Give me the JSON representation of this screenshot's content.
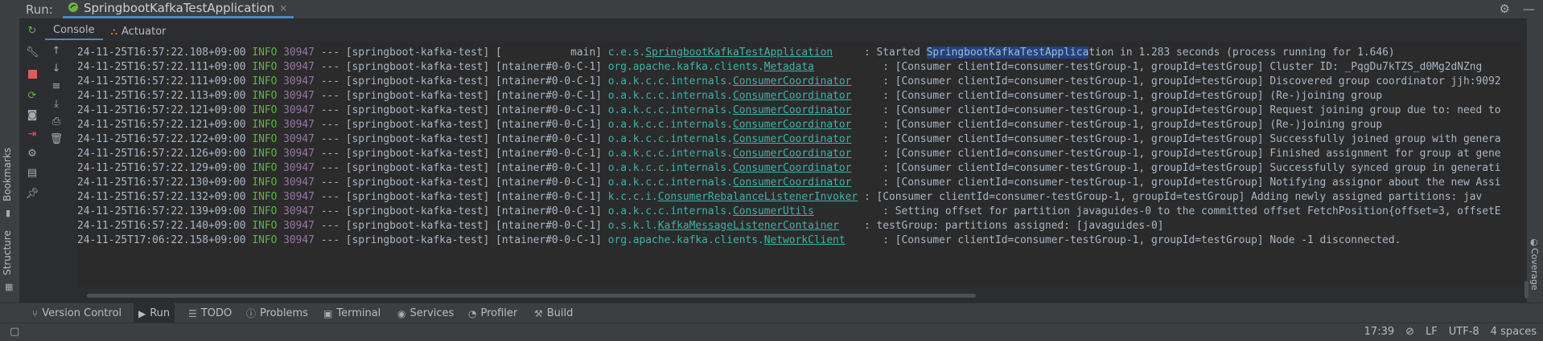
{
  "titlebar": {
    "run_label": "Run:",
    "tab_name": "SpringbootKafkaTestApplication",
    "close_glyph": "×"
  },
  "sidebar": {
    "bookmarks": "Bookmarks",
    "structure": "Structure",
    "coverage": "Coverage"
  },
  "subtabs": [
    {
      "label": "Console"
    },
    {
      "label": "Actuator"
    }
  ],
  "log": [
    {
      "ts": "24-11-25T16:57:22.108+09:00",
      "level": "INFO",
      "pid": "30947",
      "sep": "---",
      "app": "[springboot-kafka-test]",
      "thread": "[           main]",
      "logger_prefix": "c.e.s.",
      "logger_link": "SpringbootKafkaTestApplication",
      "logger_pad": "     ",
      "msg_pre": ": Started ",
      "msg_hl": "SpringbootKafkaTestApplica",
      "msg_post": "tion in 1.283 seconds (process running for 1.646)"
    },
    {
      "ts": "24-11-25T16:57:22.111+09:00",
      "level": "INFO",
      "pid": "30947",
      "sep": "---",
      "app": "[springboot-kafka-test]",
      "thread": "[ntainer#0-0-C-1]",
      "logger_prefix": "org.apache.kafka.clients.",
      "logger_link": "Metadata",
      "logger_pad": "           ",
      "msg_pre": ": [Consumer clientId=consumer-testGroup-1, groupId=testGroup] Cluster ID: _PqgDu7kTZS_d0Mg2dNZng",
      "msg_hl": "",
      "msg_post": ""
    },
    {
      "ts": "24-11-25T16:57:22.111+09:00",
      "level": "INFO",
      "pid": "30947",
      "sep": "---",
      "app": "[springboot-kafka-test]",
      "thread": "[ntainer#0-0-C-1]",
      "logger_prefix": "o.a.k.c.c.internals.",
      "logger_link": "ConsumerCoordinator",
      "logger_pad": "     ",
      "msg_pre": ": [Consumer clientId=consumer-testGroup-1, groupId=testGroup] Discovered group coordinator jjh:9092",
      "msg_hl": "",
      "msg_post": ""
    },
    {
      "ts": "24-11-25T16:57:22.113+09:00",
      "level": "INFO",
      "pid": "30947",
      "sep": "---",
      "app": "[springboot-kafka-test]",
      "thread": "[ntainer#0-0-C-1]",
      "logger_prefix": "o.a.k.c.c.internals.",
      "logger_link": "ConsumerCoordinator",
      "logger_pad": "     ",
      "msg_pre": ": [Consumer clientId=consumer-testGroup-1, groupId=testGroup] (Re-)joining group",
      "msg_hl": "",
      "msg_post": ""
    },
    {
      "ts": "24-11-25T16:57:22.121+09:00",
      "level": "INFO",
      "pid": "30947",
      "sep": "---",
      "app": "[springboot-kafka-test]",
      "thread": "[ntainer#0-0-C-1]",
      "logger_prefix": "o.a.k.c.c.internals.",
      "logger_link": "ConsumerCoordinator",
      "logger_pad": "     ",
      "msg_pre": ": [Consumer clientId=consumer-testGroup-1, groupId=testGroup] Request joining group due to: need to",
      "msg_hl": "",
      "msg_post": ""
    },
    {
      "ts": "24-11-25T16:57:22.121+09:00",
      "level": "INFO",
      "pid": "30947",
      "sep": "---",
      "app": "[springboot-kafka-test]",
      "thread": "[ntainer#0-0-C-1]",
      "logger_prefix": "o.a.k.c.c.internals.",
      "logger_link": "ConsumerCoordinator",
      "logger_pad": "     ",
      "msg_pre": ": [Consumer clientId=consumer-testGroup-1, groupId=testGroup] (Re-)joining group",
      "msg_hl": "",
      "msg_post": ""
    },
    {
      "ts": "24-11-25T16:57:22.122+09:00",
      "level": "INFO",
      "pid": "30947",
      "sep": "---",
      "app": "[springboot-kafka-test]",
      "thread": "[ntainer#0-0-C-1]",
      "logger_prefix": "o.a.k.c.c.internals.",
      "logger_link": "ConsumerCoordinator",
      "logger_pad": "     ",
      "msg_pre": ": [Consumer clientId=consumer-testGroup-1, groupId=testGroup] Successfully joined group with genera",
      "msg_hl": "",
      "msg_post": ""
    },
    {
      "ts": "24-11-25T16:57:22.126+09:00",
      "level": "INFO",
      "pid": "30947",
      "sep": "---",
      "app": "[springboot-kafka-test]",
      "thread": "[ntainer#0-0-C-1]",
      "logger_prefix": "o.a.k.c.c.internals.",
      "logger_link": "ConsumerCoordinator",
      "logger_pad": "     ",
      "msg_pre": ": [Consumer clientId=consumer-testGroup-1, groupId=testGroup] Finished assignment for group at gene",
      "msg_hl": "",
      "msg_post": ""
    },
    {
      "ts": "24-11-25T16:57:22.129+09:00",
      "level": "INFO",
      "pid": "30947",
      "sep": "---",
      "app": "[springboot-kafka-test]",
      "thread": "[ntainer#0-0-C-1]",
      "logger_prefix": "o.a.k.c.c.internals.",
      "logger_link": "ConsumerCoordinator",
      "logger_pad": "     ",
      "msg_pre": ": [Consumer clientId=consumer-testGroup-1, groupId=testGroup] Successfully synced group in generati",
      "msg_hl": "",
      "msg_post": ""
    },
    {
      "ts": "24-11-25T16:57:22.130+09:00",
      "level": "INFO",
      "pid": "30947",
      "sep": "---",
      "app": "[springboot-kafka-test]",
      "thread": "[ntainer#0-0-C-1]",
      "logger_prefix": "o.a.k.c.c.internals.",
      "logger_link": "ConsumerCoordinator",
      "logger_pad": "     ",
      "msg_pre": ": [Consumer clientId=consumer-testGroup-1, groupId=testGroup] Notifying assignor about the new Assi",
      "msg_hl": "",
      "msg_post": ""
    },
    {
      "ts": "24-11-25T16:57:22.132+09:00",
      "level": "INFO",
      "pid": "30947",
      "sep": "---",
      "app": "[springboot-kafka-test]",
      "thread": "[ntainer#0-0-C-1]",
      "logger_prefix": "k.c.c.i.",
      "logger_link": "ConsumerRebalanceListenerInvoker",
      "logger_pad": " ",
      "msg_pre": ": [Consumer clientId=consumer-testGroup-1, groupId=testGroup] Adding newly assigned partitions: jav",
      "msg_hl": "",
      "msg_post": ""
    },
    {
      "ts": "24-11-25T16:57:22.139+09:00",
      "level": "INFO",
      "pid": "30947",
      "sep": "---",
      "app": "[springboot-kafka-test]",
      "thread": "[ntainer#0-0-C-1]",
      "logger_prefix": "o.a.k.c.c.internals.",
      "logger_link": "ConsumerUtils",
      "logger_pad": "           ",
      "msg_pre": ": Setting offset for partition javaguides-0 to the committed offset FetchPosition{offset=3, offsetE",
      "msg_hl": "",
      "msg_post": ""
    },
    {
      "ts": "24-11-25T16:57:22.140+09:00",
      "level": "INFO",
      "pid": "30947",
      "sep": "---",
      "app": "[springboot-kafka-test]",
      "thread": "[ntainer#0-0-C-1]",
      "logger_prefix": "o.s.k.l.",
      "logger_link": "KafkaMessageListenerContainer",
      "logger_pad": "    ",
      "msg_pre": ": testGroup: partitions assigned: [javaguides-0]",
      "msg_hl": "",
      "msg_post": ""
    },
    {
      "ts": "24-11-25T17:06:22.158+09:00",
      "level": "INFO",
      "pid": "30947",
      "sep": "---",
      "app": "[springboot-kafka-test]",
      "thread": "[ntainer#0-0-C-1]",
      "logger_prefix": "org.apache.kafka.clients.",
      "logger_link": "NetworkClient",
      "logger_pad": "      ",
      "msg_pre": ": [Consumer clientId=consumer-testGroup-1, groupId=testGroup] Node -1 disconnected.",
      "msg_hl": "",
      "msg_post": ""
    }
  ],
  "bottom_tabs": [
    {
      "label": "Version Control",
      "icon": "version-control-icon"
    },
    {
      "label": "Run",
      "icon": "run-icon"
    },
    {
      "label": "TODO",
      "icon": "todo-icon"
    },
    {
      "label": "Problems",
      "icon": "problems-icon"
    },
    {
      "label": "Terminal",
      "icon": "terminal-icon"
    },
    {
      "label": "Services",
      "icon": "services-icon"
    },
    {
      "label": "Profiler",
      "icon": "profiler-icon"
    },
    {
      "label": "Build",
      "icon": "build-icon"
    }
  ],
  "status": {
    "position": "17:39",
    "line_sep": "LF",
    "encoding": "UTF-8",
    "indent": "4 spaces"
  },
  "colors": {
    "accent": "#4a88c7",
    "info": "#5fb346",
    "pid": "#9876aa",
    "logger": "#3db3a8",
    "highlight": "#214283"
  }
}
